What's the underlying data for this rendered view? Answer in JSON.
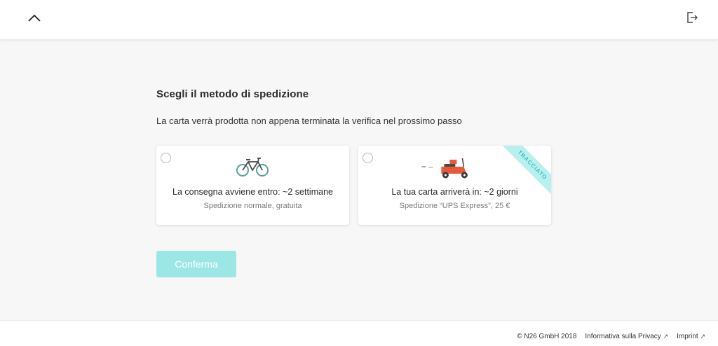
{
  "header": {
    "back_icon": "chevron-up-icon",
    "logout_icon": "logout-icon"
  },
  "main": {
    "title": "Scegli il metodo di spedizione",
    "subtitle": "La carta verrà prodotta non appena terminata la verifica nel prossimo passo",
    "options": [
      {
        "icon": "bicycle-icon",
        "title": "La consegna avviene entro: ~2 settimane",
        "subtitle": "Spedizione normale, gratuita",
        "selected": false
      },
      {
        "icon": "scooter-icon",
        "title": "La tua carta arriverà in: ~2 giorni",
        "subtitle": "Spedizione “UPS Express”, 25 €",
        "ribbon": "TRACCIATO",
        "selected": false
      }
    ],
    "confirm_label": "Conferma"
  },
  "footer": {
    "copyright": "© N26 GmbH 2018",
    "privacy": "Informativa sulla Privacy",
    "imprint": "Imprint",
    "external_icon": "external-link-icon"
  },
  "colors": {
    "accent": "#9de6e6",
    "ribbon_bg": "#b8f0ef",
    "ribbon_text": "#3cbfbf",
    "scooter": "#e8593a",
    "bicycle": "#5a9e9c",
    "background": "#f7f7f7"
  }
}
